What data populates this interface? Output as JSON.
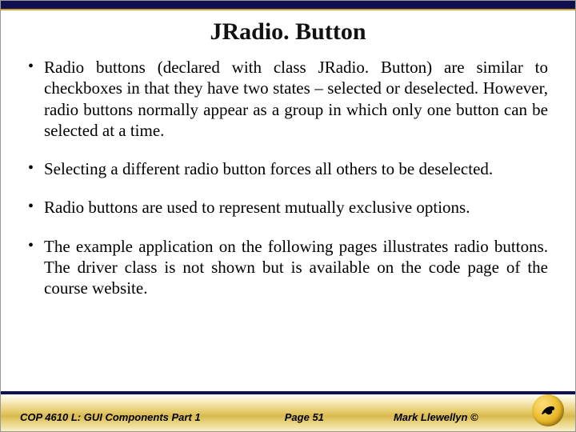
{
  "title": "JRadio. Button",
  "bullets": [
    "Radio buttons (declared with class JRadio. Button) are similar to checkboxes in that they have two states – selected or deselected.  However, radio buttons normally appear as a group in which only one button can be selected at a time.",
    "Selecting a different radio button forces all others to be deselected.",
    "Radio buttons are used to represent mutually exclusive options.",
    "The example application on the following pages illustrates radio buttons.   The driver class is not shown but is available on the code page of the course website."
  ],
  "footer": {
    "left": "COP 4610 L: GUI Components Part 1",
    "center": "Page 51",
    "right": "Mark Llewellyn ©"
  }
}
